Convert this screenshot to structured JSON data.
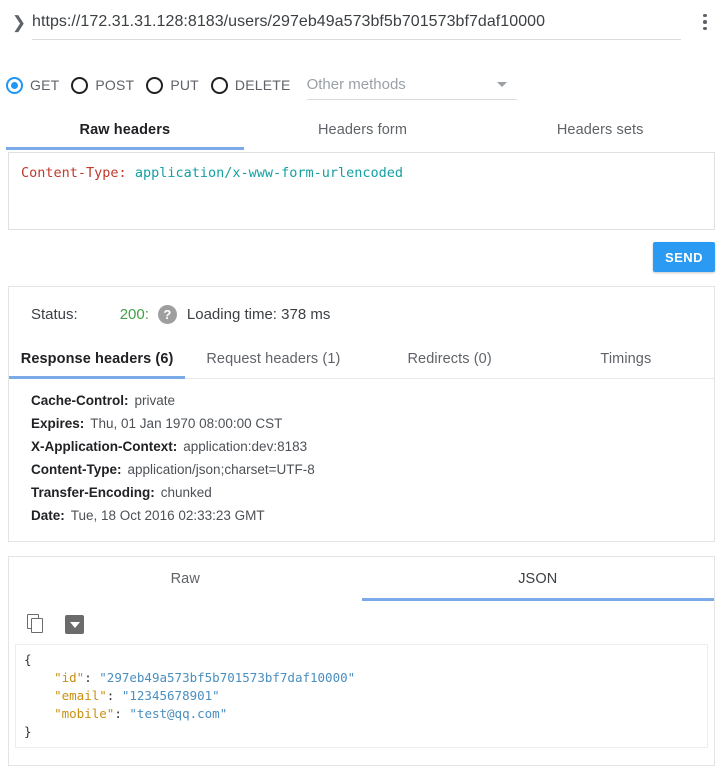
{
  "urlbar": {
    "expand_icon": "chevron-right-icon",
    "url": "https://172.31.31.128:8183/users/297eb49a573bf5b701573bf7daf10000",
    "menu_icon": "kebab-menu-icon"
  },
  "methods": {
    "options": [
      {
        "label": "GET",
        "selected": true
      },
      {
        "label": "POST",
        "selected": false
      },
      {
        "label": "PUT",
        "selected": false
      },
      {
        "label": "DELETE",
        "selected": false
      }
    ],
    "other_placeholder": "Other methods",
    "caret_icon": "chevron-down-icon"
  },
  "request_tabs": [
    {
      "label": "Raw headers",
      "active": true
    },
    {
      "label": "Headers form",
      "active": false
    },
    {
      "label": "Headers sets",
      "active": false
    }
  ],
  "raw_headers": {
    "key": "Content-Type:",
    "value": "application/x-www-form-urlencoded",
    "key_color": "#c0392b",
    "value_color": "#16a0a0"
  },
  "send": {
    "label": "SEND",
    "color": "#2b9af3"
  },
  "response": {
    "status_label": "Status:",
    "status_code": "200:",
    "status_color": "#43a047",
    "help_icon": "help-question-icon",
    "help_glyph": "?",
    "loading_time": "Loading time: 378 ms",
    "tabs": [
      {
        "label": "Response headers (6)",
        "active": true
      },
      {
        "label": "Request headers (1)",
        "active": false
      },
      {
        "label": "Redirects (0)",
        "active": false
      },
      {
        "label": "Timings",
        "active": false
      }
    ],
    "headers": [
      {
        "name": "Cache-Control:",
        "value": "private"
      },
      {
        "name": "Expires:",
        "value": "Thu, 01 Jan 1970 08:00:00 CST"
      },
      {
        "name": "X-Application-Context:",
        "value": "application:dev:8183"
      },
      {
        "name": "Content-Type:",
        "value": "application/json;charset=UTF-8"
      },
      {
        "name": "Transfer-Encoding:",
        "value": "chunked"
      },
      {
        "name": "Date:",
        "value": "Tue, 18 Oct 2016 02:33:23 GMT"
      }
    ]
  },
  "body": {
    "tabs": [
      {
        "label": "Raw",
        "active": false
      },
      {
        "label": "JSON",
        "active": true
      }
    ],
    "copy_icon": "copy-icon",
    "save_icon": "download-save-icon",
    "json_lines": [
      {
        "indent": 0,
        "punc_before": "{",
        "key": "",
        "key_quoted": "",
        "sep": "",
        "value": "",
        "punc_after": ""
      },
      {
        "indent": 1,
        "punc_before": "",
        "key": "\"id\"",
        "sep": ": ",
        "value": "\"297eb49a573bf5b701573bf7daf10000\"",
        "punc_after": ""
      },
      {
        "indent": 1,
        "punc_before": "",
        "key": "\"email\"",
        "sep": ": ",
        "value": "\"12345678901\"",
        "punc_after": ""
      },
      {
        "indent": 1,
        "punc_before": "",
        "key": "\"mobile\"",
        "sep": ": ",
        "value": "\"test@qq.com\"",
        "punc_after": ""
      },
      {
        "indent": 0,
        "punc_before": "}",
        "key": "",
        "sep": "",
        "value": "",
        "punc_after": ""
      }
    ],
    "json_key_color": "#c89112",
    "json_string_color": "#4a8fc0"
  }
}
